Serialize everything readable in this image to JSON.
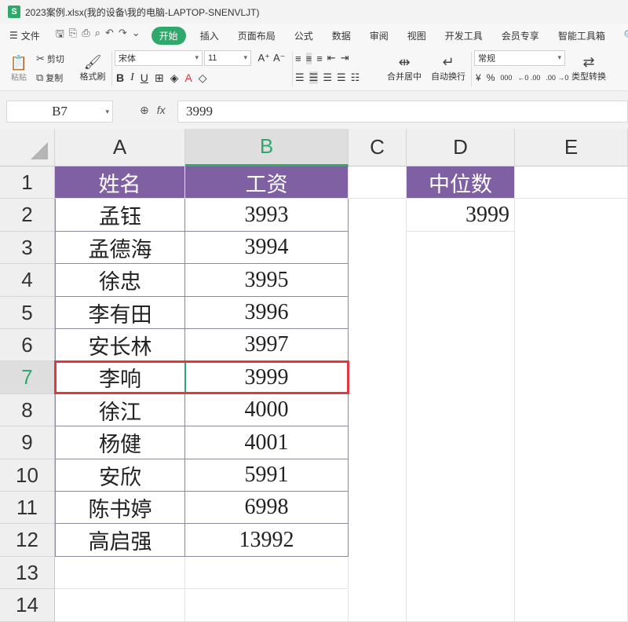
{
  "window": {
    "app_icon": "S",
    "title": "2023案例.xlsx(我的设备\\我的电脑-LAPTOP-SNENVLJT)"
  },
  "menu": {
    "file": "文件",
    "items": [
      "开始",
      "插入",
      "页面布局",
      "公式",
      "数据",
      "审阅",
      "视图",
      "开发工具",
      "会员专享",
      "智能工具箱"
    ],
    "active_index": 0
  },
  "ribbon": {
    "paste": "粘贴",
    "cut": "剪切",
    "copy": "复制",
    "format_painter": "格式刷",
    "font_name": "宋体",
    "font_size": "11",
    "merge_center": "合并居中",
    "wrap_text": "自动换行",
    "number_format": "常规",
    "type_convert": "类型转换",
    "currency": "¥",
    "percent": "%",
    "thousands": "000",
    "dec_inc": "←0 .00",
    "dec_dec": ".00 →0"
  },
  "formula_bar": {
    "cell_ref": "B7",
    "fx": "fx",
    "formula": "3999"
  },
  "columns": [
    "A",
    "B",
    "C",
    "D",
    "E"
  ],
  "active_column": "B",
  "rows": [
    "1",
    "2",
    "3",
    "4",
    "5",
    "6",
    "7",
    "8",
    "9",
    "10",
    "11",
    "12",
    "13",
    "14"
  ],
  "active_row": "7",
  "table": {
    "headers": [
      "姓名",
      "工资"
    ],
    "names": [
      "孟钰",
      "孟德海",
      "徐忠",
      "李有田",
      "安长林",
      "李响",
      "徐江",
      "杨健",
      "安欣",
      "陈书婷",
      "高启强"
    ],
    "salaries": [
      "3993",
      "3994",
      "3995",
      "3996",
      "3997",
      "3999",
      "4000",
      "4001",
      "5991",
      "6998",
      "13992"
    ]
  },
  "median": {
    "header": "中位数",
    "value": "3999"
  },
  "colors": {
    "accent": "#2fa86b",
    "header_fill": "#7f60a3",
    "highlight": "#e0383e"
  }
}
